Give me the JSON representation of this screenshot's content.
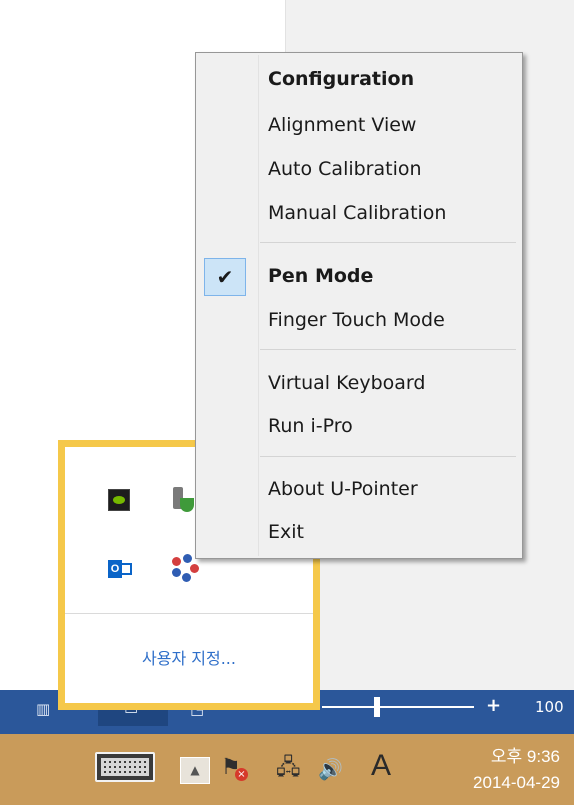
{
  "context_menu": {
    "items": [
      {
        "label": "Configuration",
        "bold": true
      },
      {
        "label": "Alignment View"
      },
      {
        "label": "Auto Calibration"
      },
      {
        "label": "Manual Calibration"
      },
      {
        "label": "Pen Mode",
        "bold": true,
        "checked": true
      },
      {
        "label": "Finger Touch Mode"
      },
      {
        "label": "Virtual Keyboard"
      },
      {
        "label": "Run i-Pro"
      },
      {
        "label": "About U-Pointer"
      },
      {
        "label": "Exit"
      }
    ],
    "check_glyph": "✔"
  },
  "tray_popup": {
    "icons": [
      "nvidia-icon",
      "usb-safe-remove-icon",
      "outlook-icon",
      "u-pointer-icon"
    ],
    "customize_label": "사용자 지정..."
  },
  "status_bar": {
    "zoom_plus": "+",
    "zoom_value": "100"
  },
  "taskbar": {
    "ime_label": "A",
    "clock_time": "오후 9:36",
    "clock_date": "2014-04-29",
    "icons": [
      "keyboard-icon",
      "show-hidden-icons-icon",
      "action-center-flag-icon",
      "network-icon",
      "volume-icon",
      "ime-icon"
    ]
  },
  "colors": {
    "taskbar": "#c99b5a",
    "status_bar": "#2b579a",
    "tray_popup_border": "#f5c84a",
    "menu_bg": "#f0f0f0",
    "check_highlight": "#cce4f7",
    "link": "#2f6fc9"
  }
}
